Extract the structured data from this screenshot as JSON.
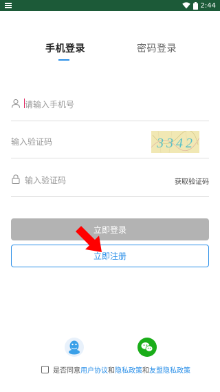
{
  "status_bar": {
    "time": "2:44"
  },
  "tabs": [
    {
      "label": "手机登录",
      "active": true
    },
    {
      "label": "密码登录",
      "active": false
    }
  ],
  "form": {
    "phone_placeholder": "请输入手机号",
    "captcha_placeholder": "输入验证码",
    "captcha_image_text": "3342",
    "sms_placeholder": "输入验证码",
    "sms_button": "获取验证码"
  },
  "buttons": {
    "login": "立即登录",
    "register": "立即注册"
  },
  "social": {
    "qq_icon": "qq-icon",
    "wechat_icon": "wechat-icon"
  },
  "agreement": {
    "prefix": "是否同意",
    "user_agreement": "用户协议",
    "and1": "和",
    "privacy_policy": "隐私政策",
    "and2": "和",
    "alliance_privacy": "友盟隐私政策",
    "checked": false
  },
  "colors": {
    "accent": "#2a8fe8",
    "status_bar": "#1c5a38",
    "disabled_button": "#b3b3b3",
    "annotation_arrow": "#ff0000",
    "wechat": "#1aad19"
  }
}
